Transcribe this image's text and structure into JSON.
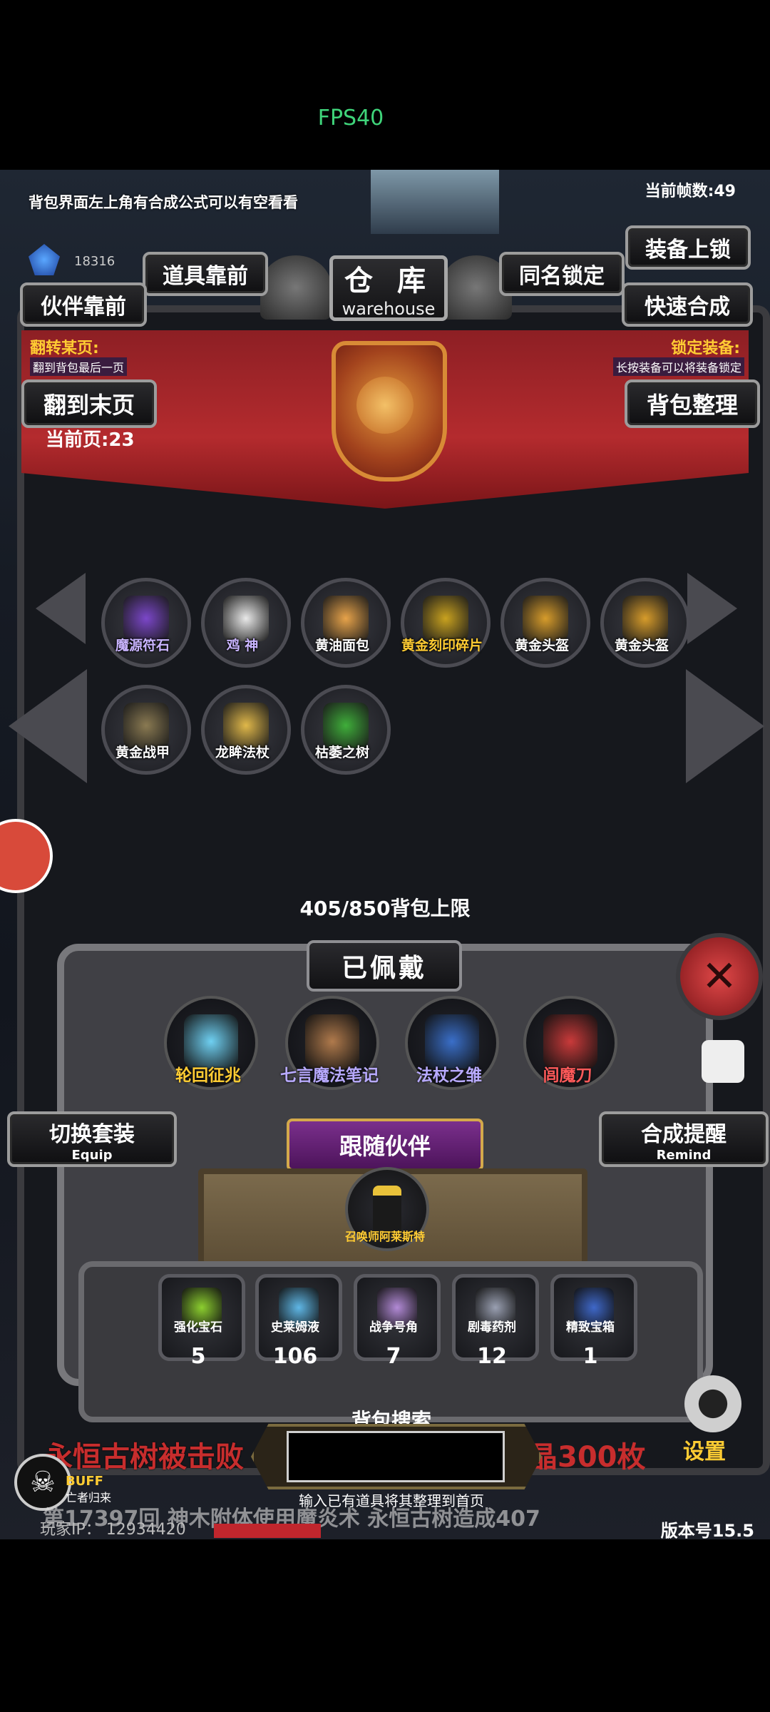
{
  "status": {
    "fps": "FPS40"
  },
  "top": {
    "notice": "背包界面左上角有合成公式可以有空看看",
    "frame_count": "当前帧数:49",
    "crystal_count": "18316"
  },
  "title": {
    "cn": "仓 库",
    "en": "warehouse"
  },
  "buttons": {
    "item_front": "道具靠前",
    "partner_front": "伙伴靠前",
    "same_name_lock": "同名锁定",
    "equip_lock": "装备上锁",
    "quick_merge": "快速合成",
    "last_page": "翻到末页",
    "sort_bag": "背包整理"
  },
  "banner": {
    "flip_title": "翻转某页:",
    "flip_sub": "翻到背包最后一页",
    "lock_title": "锁定装备:",
    "lock_sub": "长按装备可以将装备锁定",
    "current_page": "当前页:23"
  },
  "items": [
    {
      "label": "魔源符石",
      "color": "#7b47c9",
      "label_color": "#c9b4ff"
    },
    {
      "label": "鸡 神",
      "color": "#e9e9e9",
      "label_color": "#c9b4ff"
    },
    {
      "label": "黄油面包",
      "color": "#e7a34a",
      "label_color": "#ffffff"
    },
    {
      "label": "黄金刻印碎片",
      "color": "#c9a21f",
      "label_color": "#ffcc33"
    },
    {
      "label": "黄金头盔",
      "color": "#d79c2b",
      "label_color": "#ffffff"
    },
    {
      "label": "黄金头盔",
      "color": "#d79c2b",
      "label_color": "#ffffff"
    },
    {
      "label": "黄金战甲",
      "color": "#8a7a52",
      "label_color": "#ffffff"
    },
    {
      "label": "龙眸法杖",
      "color": "#e0b84a",
      "label_color": "#ffffff"
    },
    {
      "label": "枯萎之树",
      "color": "#3fae3a",
      "label_color": "#ffffff"
    }
  ],
  "capacity": "405/850背包上限",
  "equipped": {
    "title": "已佩戴",
    "slots": [
      {
        "label": "轮回征兆",
        "color": "#6fd0f2",
        "label_color": "#ffcc33"
      },
      {
        "label": "七言魔法笔记",
        "color": "#b07a4c",
        "label_color": "#b8aaff"
      },
      {
        "label": "法杖之雏",
        "color": "#3a6fc9",
        "label_color": "#b8aaff"
      },
      {
        "label": "闾魔刀",
        "color": "#c93a3a",
        "label_color": "#ff5a5a"
      }
    ]
  },
  "side": {
    "switch_set": "切换套装",
    "switch_set_en": "Equip",
    "merge_remind": "合成提醒",
    "merge_remind_en": "Remind",
    "follow_partner": "跟随伙伴",
    "partner_name": "召唤师阿莱斯特"
  },
  "consumables": [
    {
      "label": "强化宝石",
      "count": "5",
      "color": "#8ccf2f"
    },
    {
      "label": "史莱姆液",
      "count": "106",
      "color": "#5fb7e6"
    },
    {
      "label": "战争号角",
      "count": "7",
      "color": "#b28ad6"
    },
    {
      "label": "剧毒药剂",
      "count": "12",
      "color": "#9aa0b2"
    },
    {
      "label": "精致宝箱",
      "count": "1",
      "color": "#3f68c9"
    }
  ],
  "search": {
    "title": "背包搜索",
    "hint": "输入已有道具将其整理到首页",
    "value": ""
  },
  "bottom": {
    "kill_msg_a": "永恒古树被击败",
    "kill_msg_b": "晶300枚",
    "settings": "设置",
    "buff": "BUFF",
    "buff_sub": "亡者归来",
    "player_ip": "玩家IP：  12934420",
    "version": "版本号15.5",
    "marquee": "第17397回 神木附体使用魔炎术 永恒古树造成407"
  }
}
